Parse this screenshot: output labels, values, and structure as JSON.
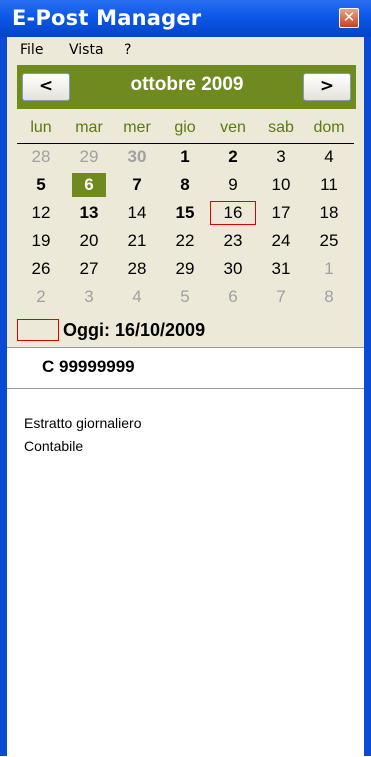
{
  "window": {
    "title": "E-Post Manager",
    "close_glyph": "✕"
  },
  "menu": {
    "items": [
      "File",
      "Vista",
      "?"
    ]
  },
  "calendar": {
    "month_title": "ottobre 2009",
    "prev_glyph": "<",
    "next_glyph": ">",
    "weekdays": [
      "lun",
      "mar",
      "mer",
      "gio",
      "ven",
      "sab",
      "dom"
    ],
    "weeks": [
      [
        {
          "d": "28",
          "s": "muted"
        },
        {
          "d": "29",
          "s": "muted"
        },
        {
          "d": "30",
          "s": "muted bold"
        },
        {
          "d": "1",
          "s": "bold"
        },
        {
          "d": "2",
          "s": "bold"
        },
        {
          "d": "3",
          "s": ""
        },
        {
          "d": "4",
          "s": ""
        }
      ],
      [
        {
          "d": "5",
          "s": "bold"
        },
        {
          "d": "6",
          "s": "selected"
        },
        {
          "d": "7",
          "s": "bold"
        },
        {
          "d": "8",
          "s": "bold"
        },
        {
          "d": "9",
          "s": ""
        },
        {
          "d": "10",
          "s": ""
        },
        {
          "d": "11",
          "s": ""
        }
      ],
      [
        {
          "d": "12",
          "s": ""
        },
        {
          "d": "13",
          "s": "bold"
        },
        {
          "d": "14",
          "s": ""
        },
        {
          "d": "15",
          "s": "bold"
        },
        {
          "d": "16",
          "s": "today"
        },
        {
          "d": "17",
          "s": ""
        },
        {
          "d": "18",
          "s": ""
        }
      ],
      [
        {
          "d": "19",
          "s": ""
        },
        {
          "d": "20",
          "s": ""
        },
        {
          "d": "21",
          "s": ""
        },
        {
          "d": "22",
          "s": ""
        },
        {
          "d": "23",
          "s": ""
        },
        {
          "d": "24",
          "s": ""
        },
        {
          "d": "25",
          "s": ""
        }
      ],
      [
        {
          "d": "26",
          "s": ""
        },
        {
          "d": "27",
          "s": ""
        },
        {
          "d": "28",
          "s": ""
        },
        {
          "d": "29",
          "s": ""
        },
        {
          "d": "30",
          "s": ""
        },
        {
          "d": "31",
          "s": ""
        },
        {
          "d": "1",
          "s": "muted"
        }
      ],
      [
        {
          "d": "2",
          "s": "muted"
        },
        {
          "d": "3",
          "s": "muted"
        },
        {
          "d": "4",
          "s": "muted"
        },
        {
          "d": "5",
          "s": "muted"
        },
        {
          "d": "6",
          "s": "muted"
        },
        {
          "d": "7",
          "s": "muted"
        },
        {
          "d": "8",
          "s": "muted"
        }
      ]
    ],
    "today_label": "Oggi: 16/10/2009",
    "colors": {
      "header": "#6f8a1e",
      "today_border": "#e00000"
    }
  },
  "details": {
    "account": "C 99999999",
    "description": "Estratto giornaliero\nContabile"
  }
}
